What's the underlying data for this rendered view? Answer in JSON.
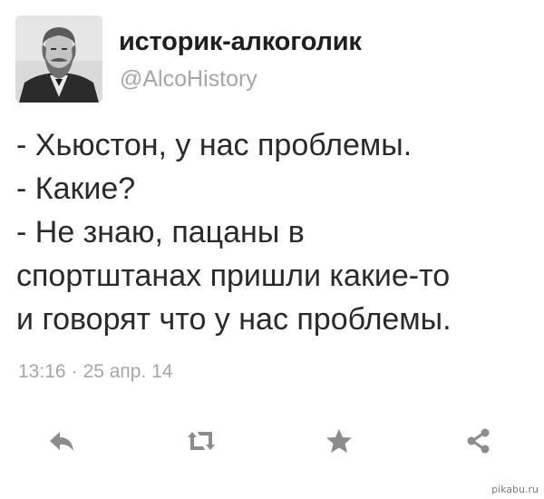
{
  "author": {
    "display_name": "историк-алкоголик",
    "handle": "@AlcoHistory"
  },
  "tweet": {
    "lines": [
      "- Хьюстон, у нас проблемы.",
      "- Какие?",
      "- Не знаю, пацаны в",
      "спортштанах пришли какие-то",
      "и говорят что у нас проблемы."
    ],
    "time": "13:16",
    "separator": "·",
    "date": "25 апр. 14"
  },
  "actions": [
    {
      "name": "reply",
      "icon": "reply-icon"
    },
    {
      "name": "retweet",
      "icon": "retweet-icon"
    },
    {
      "name": "favorite",
      "icon": "star-icon"
    },
    {
      "name": "share",
      "icon": "share-icon"
    }
  ],
  "watermark": "pikabu.ru",
  "colors": {
    "text": "#2a2a2a",
    "muted": "#a6a6a6",
    "icon": "#8c8c8c"
  }
}
